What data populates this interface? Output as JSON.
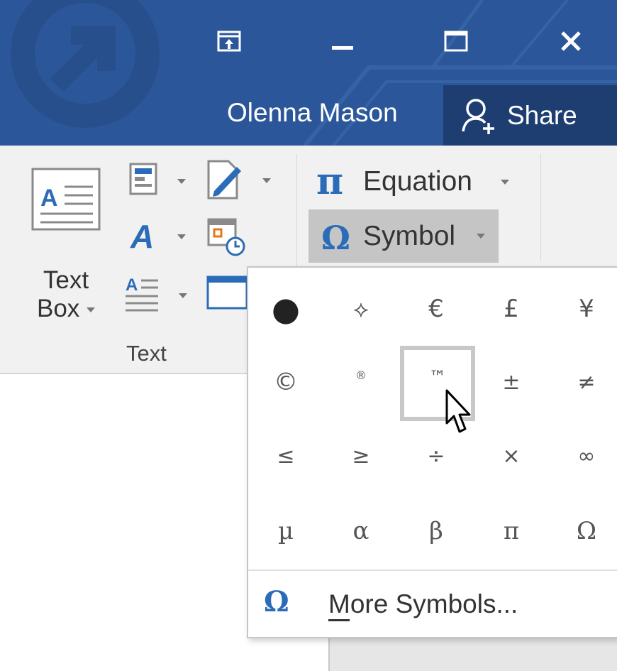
{
  "titlebar": {
    "user_name": "Olenna Mason",
    "share_label": "Share",
    "window_buttons": [
      "ribbon-display-options",
      "minimize",
      "maximize",
      "close"
    ],
    "colors": {
      "bar": "#2b579a",
      "share_bg": "#1e3e72"
    }
  },
  "ribbon": {
    "text_group": {
      "label": "Text",
      "text_box_label_1": "Text",
      "text_box_label_2": "Box"
    },
    "symbols_group": {
      "equation_label": "Equation",
      "symbol_label": "Symbol"
    }
  },
  "symbol_dropdown": {
    "symbols": [
      [
        "●",
        "⟡",
        "€",
        "£",
        "¥"
      ],
      [
        "©",
        "®",
        "™",
        "±",
        "≠"
      ],
      [
        "≤",
        "≥",
        "÷",
        "×",
        "∞"
      ],
      [
        "µ",
        "α",
        "β",
        "π",
        "Ω"
      ]
    ],
    "hovered_symbol": "™",
    "more_icon": "Ω",
    "more_label": "More Symbols..."
  }
}
